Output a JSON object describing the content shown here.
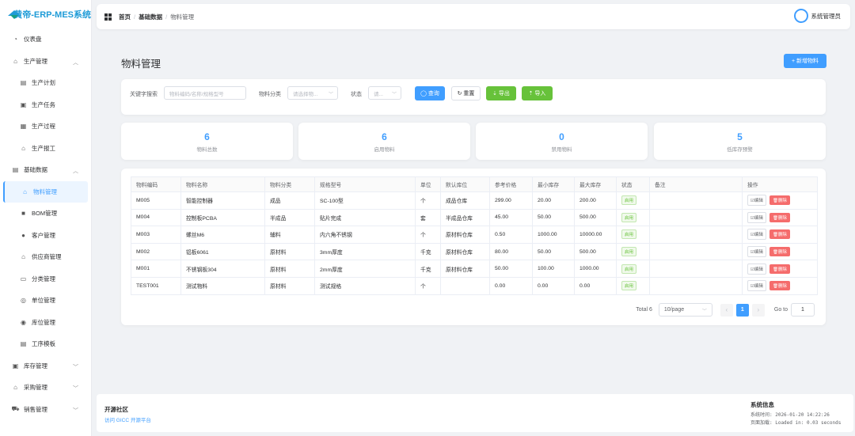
{
  "app": {
    "title": "黄帝-ERP-MES系统"
  },
  "sidebar": {
    "items": [
      {
        "label": "仪表盘",
        "icon": "dashboard-icon"
      },
      {
        "label": "生产管理",
        "icon": "factory-icon",
        "expanded": true
      },
      {
        "label": "生产计划",
        "icon": "calendar-icon",
        "sub": true
      },
      {
        "label": "生产任务",
        "icon": "task-icon",
        "sub": true
      },
      {
        "label": "生产过程",
        "icon": "process-icon",
        "sub": true
      },
      {
        "label": "生产报工",
        "icon": "report-icon",
        "sub": true
      },
      {
        "label": "基础数据",
        "icon": "database-icon",
        "expanded": true
      },
      {
        "label": "物料管理",
        "icon": "box-icon",
        "sub": true,
        "active": true
      },
      {
        "label": "BOM管理",
        "icon": "bom-icon",
        "sub": true
      },
      {
        "label": "客户管理",
        "icon": "user-icon",
        "sub": true
      },
      {
        "label": "供应商管理",
        "icon": "supplier-icon",
        "sub": true
      },
      {
        "label": "分类管理",
        "icon": "category-icon",
        "sub": true
      },
      {
        "label": "单位管理",
        "icon": "unit-icon",
        "sub": true
      },
      {
        "label": "库位管理",
        "icon": "location-icon",
        "sub": true
      },
      {
        "label": "工序模板",
        "icon": "template-icon",
        "sub": true
      },
      {
        "label": "库存管理",
        "icon": "inventory-icon",
        "expanded": false
      },
      {
        "label": "采购管理",
        "icon": "purchase-icon",
        "expanded": false
      },
      {
        "label": "销售管理",
        "icon": "cart-icon",
        "expanded": false
      }
    ]
  },
  "header": {
    "breadcrumb": [
      "首页",
      "基础数据",
      "物料管理"
    ],
    "user": "系统管理员"
  },
  "main": {
    "title": "物料管理",
    "add_button": "+ 新增物料",
    "search": {
      "keyword_label": "关键字搜索",
      "keyword_placeholder": "物料编码/名称/规格型号",
      "category_label": "物料分类",
      "category_placeholder": "请选择物...",
      "status_label": "状态",
      "status_placeholder": "请...",
      "query_button": "◯ 查询",
      "reset_button": "↻ 重置",
      "export_button": "⇣ 导出",
      "import_button": "⇡ 导入"
    },
    "stats": [
      {
        "value": "6",
        "label": "物料总数"
      },
      {
        "value": "6",
        "label": "启用物料"
      },
      {
        "value": "0",
        "label": "禁用物料"
      },
      {
        "value": "5",
        "label": "低库存预警"
      }
    ],
    "table": {
      "columns": [
        "物料编码",
        "物料名称",
        "物料分类",
        "规格型号",
        "单位",
        "默认库位",
        "参考价格",
        "最小库存",
        "最大库存",
        "状态",
        "备注",
        "操作"
      ],
      "rows": [
        {
          "code": "M005",
          "name": "智能控制器",
          "category": "成品",
          "spec": "SC-100型",
          "unit": "个",
          "location": "成品仓库",
          "price": "299.00",
          "min": "20.00",
          "max": "200.00",
          "status": "启用",
          "remark": ""
        },
        {
          "code": "M004",
          "name": "控制板PCBA",
          "category": "半成品",
          "spec": "贴片完成",
          "unit": "套",
          "location": "半成品仓库",
          "price": "45.00",
          "min": "50.00",
          "max": "500.00",
          "status": "启用",
          "remark": ""
        },
        {
          "code": "M003",
          "name": "螺丝M6",
          "category": "辅料",
          "spec": "内六角不锈钢",
          "unit": "个",
          "location": "原材料仓库",
          "price": "0.50",
          "min": "1000.00",
          "max": "10000.00",
          "status": "启用",
          "remark": ""
        },
        {
          "code": "M002",
          "name": "铝板6061",
          "category": "原材料",
          "spec": "3mm厚度",
          "unit": "千克",
          "location": "原材料仓库",
          "price": "80.00",
          "min": "50.00",
          "max": "500.00",
          "status": "启用",
          "remark": ""
        },
        {
          "code": "M001",
          "name": "不锈钢板304",
          "category": "原材料",
          "spec": "2mm厚度",
          "unit": "千克",
          "location": "原材料仓库",
          "price": "50.00",
          "min": "100.00",
          "max": "1000.00",
          "status": "启用",
          "remark": ""
        },
        {
          "code": "TEST001",
          "name": "测试物料",
          "category": "原材料",
          "spec": "测试规格",
          "unit": "个",
          "location": "",
          "price": "0.00",
          "min": "0.00",
          "max": "0.00",
          "status": "启用",
          "remark": ""
        }
      ],
      "edit_label": "☑编辑",
      "delete_label": "🗑删除"
    },
    "pagination": {
      "total": "Total 6",
      "page_size": "10/page",
      "current_page": "1",
      "goto_label": "Go to",
      "goto_value": "1"
    }
  },
  "footer": {
    "community_title": "开源社区",
    "community_link": "访问 GICC 开源平台",
    "sysinfo_title": "系统信息",
    "system_time": "系统时间:  2026-01-20 14:22:26",
    "page_load": "页面加载:  Loaded in: 0.03 seconds"
  },
  "colors": {
    "primary": "#409eff",
    "success": "#67c23a",
    "danger": "#f56c6c",
    "brand": "#1e9bd7"
  }
}
